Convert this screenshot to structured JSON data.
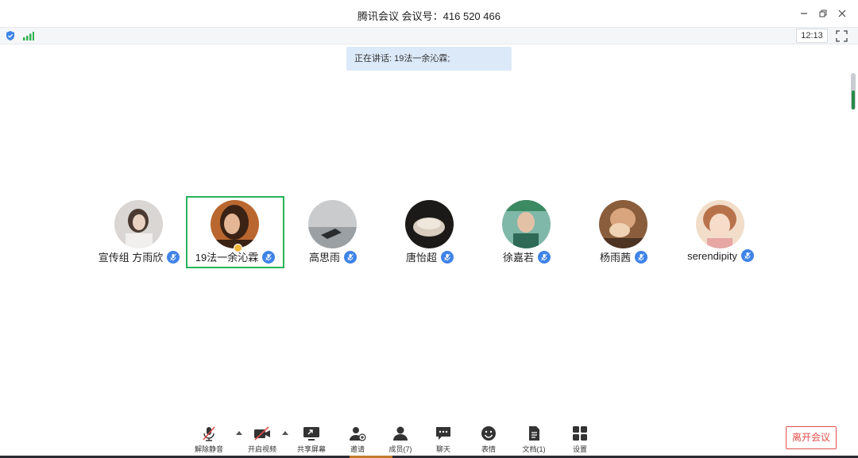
{
  "window": {
    "title": "腾讯会议 会议号：416 520 466"
  },
  "statusbar": {
    "security_icon": "shield-icon",
    "signal_icon": "signal-icon",
    "time": "12:13",
    "fullscreen_icon": "fullscreen-icon"
  },
  "speaking_banner": {
    "text": "正在讲话: 19法一余沁霖;"
  },
  "participants": [
    {
      "name": "宣传组 方雨欣",
      "mic": "mic-muted-icon",
      "active": false
    },
    {
      "name": "19法一余沁霖",
      "mic": "mic-muted-icon",
      "active": true,
      "host": true
    },
    {
      "name": "高思雨",
      "mic": "mic-muted-icon",
      "active": false
    },
    {
      "name": "唐怡超",
      "mic": "mic-muted-icon",
      "active": false
    },
    {
      "name": "徐嘉若",
      "mic": "mic-muted-icon",
      "active": false
    },
    {
      "name": "杨雨茜",
      "mic": "mic-muted-icon",
      "active": false
    },
    {
      "name": "serendipity",
      "mic": "mic-muted-icon",
      "active": false
    }
  ],
  "toolbar": {
    "unmute": "解除静音",
    "start_video": "开启视频",
    "share_screen": "共享屏幕",
    "invite": "邀请",
    "members": "成员(7)",
    "chat": "聊天",
    "reactions": "表情",
    "docs": "文档(1)",
    "settings": "设置",
    "leave": "离开会议"
  },
  "colors": {
    "accent_blue": "#3f83e8",
    "active_speaker_border": "#27b35a",
    "leave_red": "#e0504b",
    "muted_red": "#e0504b",
    "banner_bg": "#dce9f9"
  }
}
